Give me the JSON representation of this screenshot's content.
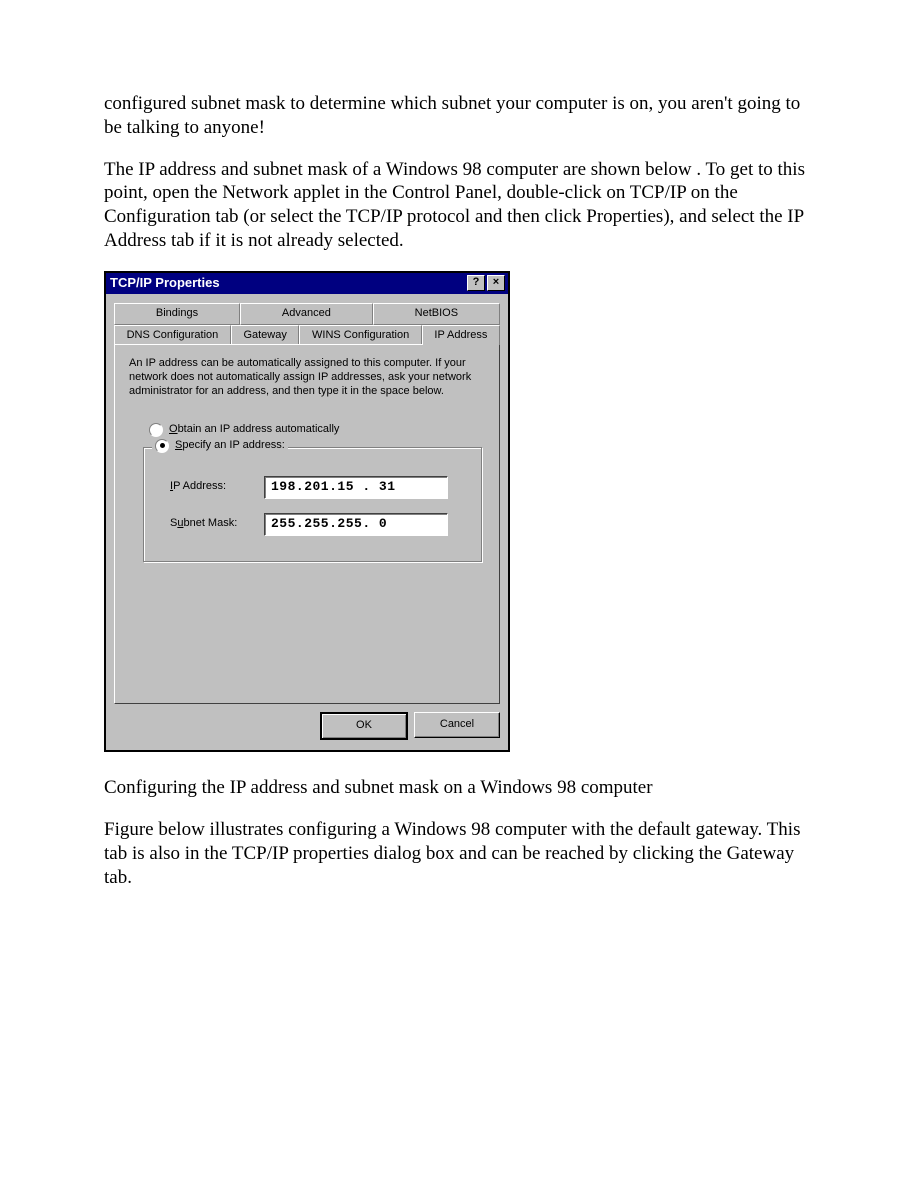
{
  "document": {
    "para1": "configured subnet mask to determine which subnet your computer is on, you aren't going to be talking to anyone!",
    "para2": "The IP address and subnet mask of a Windows 98 computer are shown below . To get to this point, open the Network applet in the Control Panel, double-click on TCP/IP on the Configuration tab (or select the TCP/IP protocol and then click Properties), and select the IP Address tab if it is not already selected.",
    "caption": "Configuring the IP address and subnet mask on a Windows 98 computer",
    "para3": "Figure below illustrates configuring a Windows 98 computer with the default gateway. This tab is also in the TCP/IP properties dialog box and can be reached by clicking the Gateway tab."
  },
  "dialog": {
    "title": "TCP/IP Properties",
    "help_btn": "?",
    "close_btn": "×",
    "tabs_row1": [
      "Bindings",
      "Advanced",
      "NetBIOS"
    ],
    "tabs_row2": [
      "DNS Configuration",
      "Gateway",
      "WINS Configuration",
      "IP Address"
    ],
    "active_tab": "IP Address",
    "panel_text": "An IP address can be automatically assigned to this computer. If your network does not automatically assign IP addresses, ask your network administrator for an address, and then type it in the space below.",
    "radio_obtain_pre": "O",
    "radio_obtain_rest": "btain an IP address automatically",
    "radio_specify_pre": "S",
    "radio_specify_rest": "pecify an IP address:",
    "ip_label_pre": "I",
    "ip_label_rest": "P Address:",
    "ip_value": "198.201.15 . 31",
    "subnet_label_pre": "u",
    "subnet_label_prefix": "S",
    "subnet_label_rest": "bnet Mask:",
    "subnet_value": "255.255.255.  0",
    "ok_btn": "OK",
    "cancel_btn": "Cancel"
  }
}
